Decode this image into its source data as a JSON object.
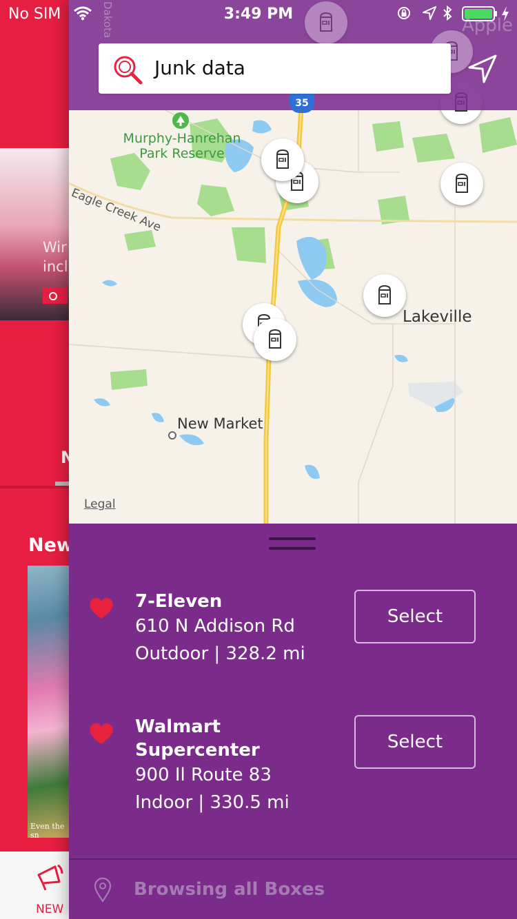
{
  "status_bar": {
    "carrier": "No SIM",
    "time": "3:49 PM",
    "battery_color": "#4cd964"
  },
  "background_app": {
    "hero_text": "Wir\nincl",
    "section_initial": "N",
    "section_title": "New",
    "poster_caption": "Even the sn",
    "tab_label": "NEW",
    "accent": "#e61e42"
  },
  "search": {
    "query": "Junk data",
    "icon": "search-icon"
  },
  "map": {
    "labels": {
      "park": "Murphy-Hanrehan Park Reserve",
      "road": "Eagle Creek Ave",
      "city1": "Lakeville",
      "city2": "New Market",
      "highway": "35",
      "region": "Dakota",
      "watermark": "Apple"
    },
    "legal": "Legal"
  },
  "results": [
    {
      "name": "7-Eleven",
      "address": "610 N Addison Rd",
      "detail": "Outdoor | 328.2 mi",
      "favorite": true,
      "action": "Select"
    },
    {
      "name": "Walmart Supercenter",
      "address": "900 Il Route 83",
      "detail": "Indoor | 330.5 mi",
      "favorite": true,
      "action": "Select"
    }
  ],
  "footer": {
    "text": "Browsing all Boxes"
  },
  "theme": {
    "panel": "#7b2c8b",
    "heart": "#e8213f",
    "highway": "#f5c842",
    "park_green": "#a8dc8f",
    "water": "#8ec9f2"
  }
}
